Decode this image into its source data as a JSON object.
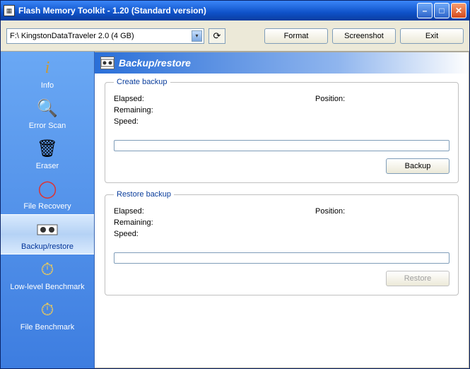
{
  "window": {
    "title": "Flash Memory Toolkit - 1.20 (Standard version)"
  },
  "toolbar": {
    "drive": "F:\\ KingstonDataTraveler 2.0 (4 GB)",
    "format_label": "Format",
    "screenshot_label": "Screenshot",
    "exit_label": "Exit"
  },
  "sidebar": {
    "items": [
      {
        "label": "Info"
      },
      {
        "label": "Error Scan"
      },
      {
        "label": "Eraser"
      },
      {
        "label": "File Recovery"
      },
      {
        "label": "Backup/restore"
      },
      {
        "label": "Low-level Benchmark"
      },
      {
        "label": "File Benchmark"
      }
    ]
  },
  "main": {
    "title": "Backup/restore",
    "create": {
      "legend": "Create backup",
      "elapsed_label": "Elapsed:",
      "position_label": "Position:",
      "remaining_label": "Remaining:",
      "speed_label": "Speed:",
      "button": "Backup"
    },
    "restore": {
      "legend": "Restore backup",
      "elapsed_label": "Elapsed:",
      "position_label": "Position:",
      "remaining_label": "Remaining:",
      "speed_label": "Speed:",
      "button": "Restore"
    }
  }
}
